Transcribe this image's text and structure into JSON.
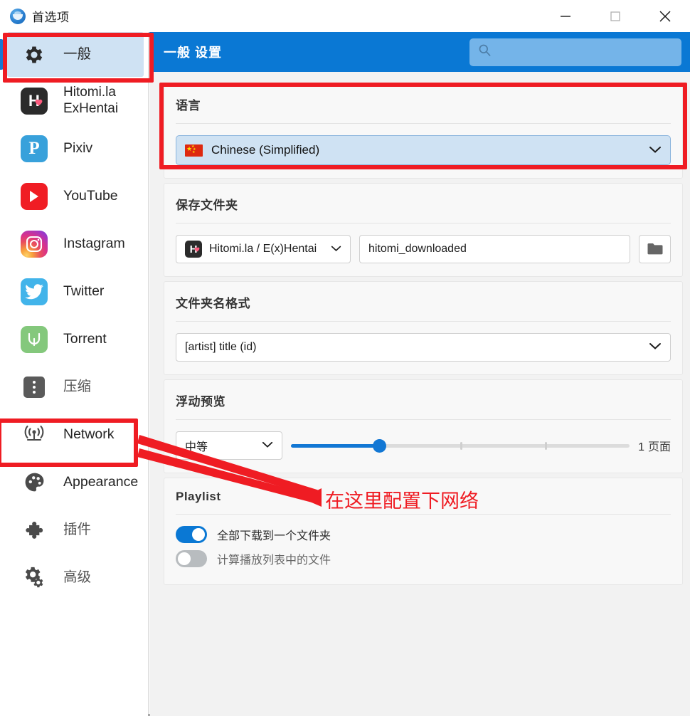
{
  "window": {
    "title": "首选项",
    "logo_icon": "app-logo-icon",
    "minimize_label": "—",
    "maximize_label": "□",
    "close_label": "✕"
  },
  "sidebar": {
    "items": [
      {
        "label": "一般",
        "icon": "gear-icon",
        "selected": true,
        "type": "gear"
      },
      {
        "label": "Hitomi.la\nExHentai",
        "icon": "hitomi-icon",
        "selected": false,
        "type": "hitomi"
      },
      {
        "label": "Pixiv",
        "icon": "pixiv-icon",
        "selected": false,
        "type": "pixiv"
      },
      {
        "label": "YouTube",
        "icon": "youtube-icon",
        "selected": false,
        "type": "youtube"
      },
      {
        "label": "Instagram",
        "icon": "instagram-icon",
        "selected": false,
        "type": "instagram"
      },
      {
        "label": "Twitter",
        "icon": "twitter-icon",
        "selected": false,
        "type": "twitter"
      },
      {
        "label": "Torrent",
        "icon": "torrent-icon",
        "selected": false,
        "type": "torrent"
      },
      {
        "label": "压缩",
        "icon": "compress-icon",
        "selected": false,
        "type": "compress"
      },
      {
        "label": "Network",
        "icon": "network-icon",
        "selected": false,
        "type": "network"
      },
      {
        "label": "Appearance",
        "icon": "palette-icon",
        "selected": false,
        "type": "palette"
      },
      {
        "label": "插件",
        "icon": "puzzle-icon",
        "selected": false,
        "type": "puzzle"
      },
      {
        "label": "高级",
        "icon": "gears-icon",
        "selected": false,
        "type": "gears"
      }
    ]
  },
  "header": {
    "title": "一般 设置",
    "search_placeholder": "",
    "search_value": "",
    "search_icon": "search-icon",
    "accent_color": "#0a78d4"
  },
  "sections": {
    "language": {
      "title": "语言",
      "selected_value": "Chinese (Simplified)",
      "flag_icon": "flag-cn-icon",
      "chevron_icon": "chevron-down-icon"
    },
    "save_folder": {
      "title": "保存文件夹",
      "site_select_value": "Hitomi.la / E(x)Hentai",
      "site_icon": "hitomi-icon",
      "path_value": "hitomi_downloaded",
      "path_placeholder": "",
      "browse_icon": "folder-icon",
      "chevron_icon": "chevron-down-icon"
    },
    "folder_name_format": {
      "title": "文件夹名格式",
      "selected_value": "[artist] title (id)",
      "chevron_icon": "chevron-down-icon"
    },
    "floating_preview": {
      "title": "浮动预览",
      "size_value": "中等",
      "chevron_icon": "chevron-down-icon",
      "slider_value": "1",
      "slider_unit": "页面",
      "slider_percent": 26
    },
    "playlist": {
      "title": "Playlist",
      "toggles": [
        {
          "label": "全部下载到一个文件夹",
          "on": true
        },
        {
          "label": "计算播放列表中的文件",
          "on": false
        }
      ]
    }
  },
  "annotations": {
    "note_text": "在这里配置下网络",
    "color": "#ef1c23"
  }
}
